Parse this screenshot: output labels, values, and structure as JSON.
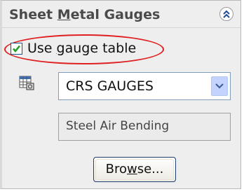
{
  "panel": {
    "title_prefix": "Sheet ",
    "title_accel": "M",
    "title_suffix": "etal Gauges",
    "collapse_icon": "double-chevron-up-icon"
  },
  "gauge_table": {
    "checkbox_checked": true,
    "label_prefix": "Use ",
    "label_accel": "g",
    "label_suffix": "auge table",
    "table_icon": "gauge-table-icon",
    "selected_value": "CRS GAUGES",
    "dropdown_icon": "chevron-down-icon"
  },
  "bend": {
    "value": "Steel Air Bending"
  },
  "browse": {
    "label_prefix": "Bro",
    "label_accel": "w",
    "label_suffix": "se..."
  },
  "colors": {
    "highlight_ellipse": "#e02020",
    "checkmark": "#21a121",
    "title_text": "#4a4a4a"
  }
}
